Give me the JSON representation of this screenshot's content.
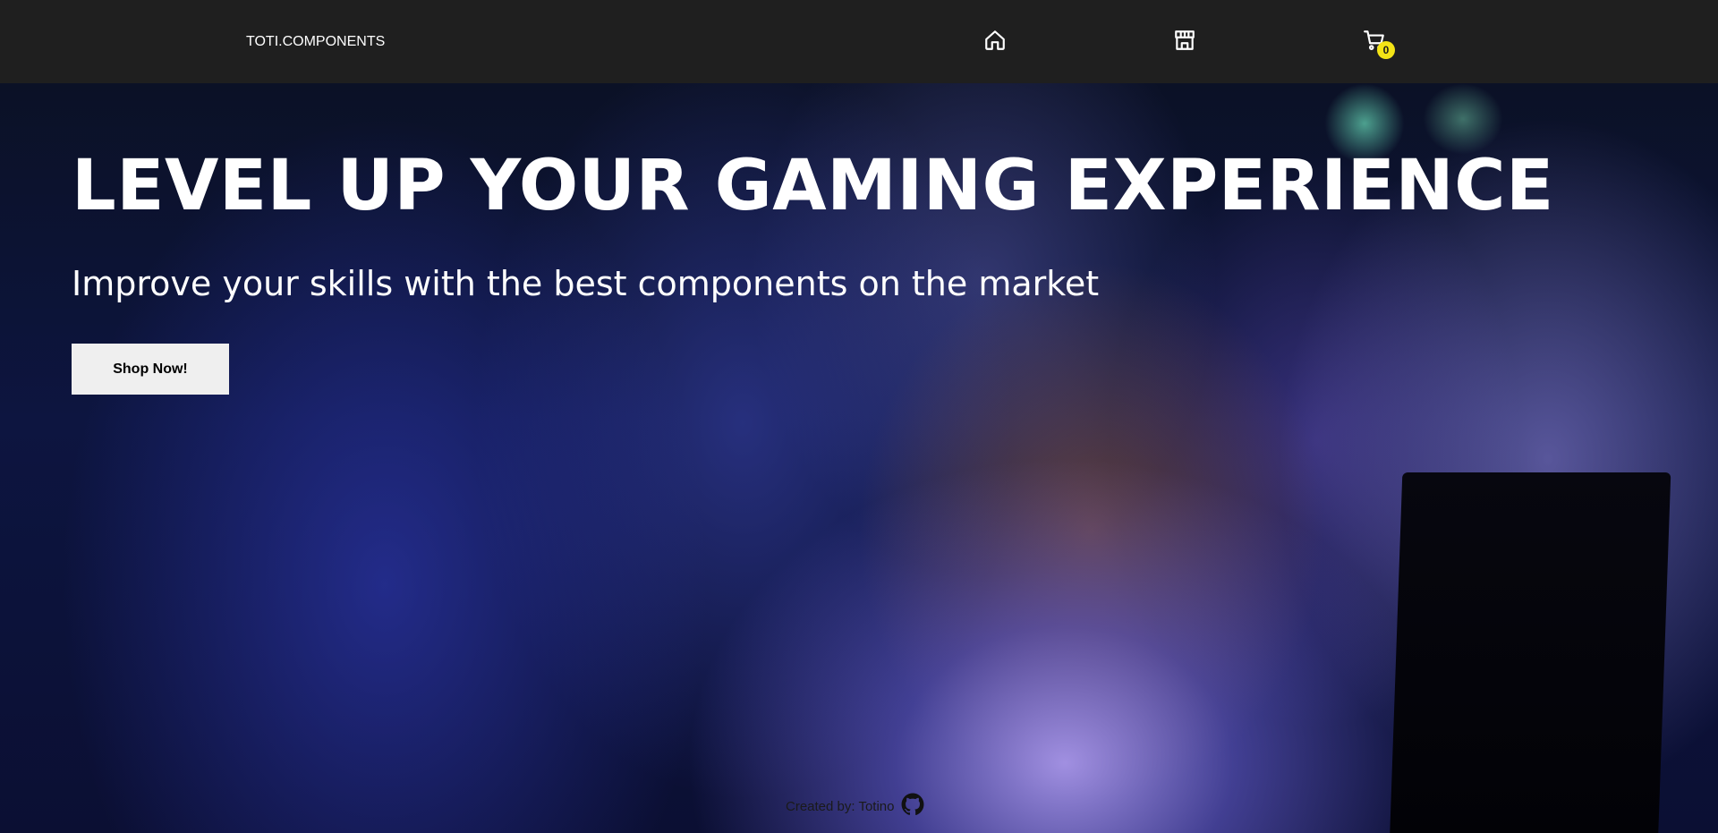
{
  "navbar": {
    "brand": "TOTI.COMPONENTS",
    "icons": {
      "home": "home-icon",
      "store": "store-icon",
      "cart": "cart-icon"
    },
    "cart_count": "0",
    "badge_color": "#f4e416",
    "background": "#1f1f1f"
  },
  "hero": {
    "title": "LEVEL UP YOUR GAMING EXPERIENCE",
    "subtitle": "Improve your skills with the best components on the market",
    "cta_label": "Shop Now!"
  },
  "footer": {
    "credit": "Created by: Totino",
    "icon": "github-icon"
  }
}
